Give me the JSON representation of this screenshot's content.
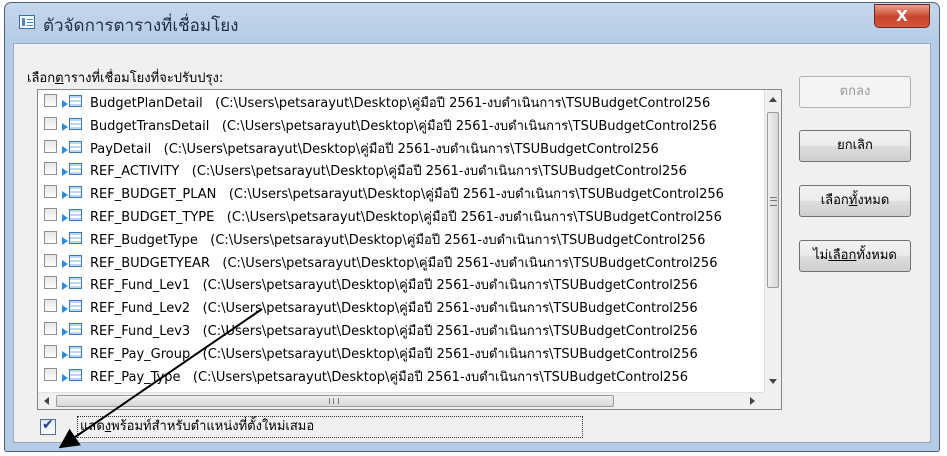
{
  "window": {
    "title": "ตัวจัดการตารางที่เชื่อมโยง",
    "close_glyph": "X"
  },
  "prompt": {
    "prefix": "เลือก",
    "accel": "ต",
    "rest": "ารางที่เชื่อมโยงที่จะปรับปรุง:"
  },
  "tables": [
    {
      "name": "BudgetPlanDetail",
      "path": "(C:\\Users\\petsarayut\\Desktop\\คู่มือปี  2561-งบดำเนินการ\\TSUBudgetControl256"
    },
    {
      "name": "BudgetTransDetail",
      "path": "(C:\\Users\\petsarayut\\Desktop\\คู่มือปี  2561-งบดำเนินการ\\TSUBudgetControl256"
    },
    {
      "name": "PayDetail",
      "path": "(C:\\Users\\petsarayut\\Desktop\\คู่มือปี  2561-งบดำเนินการ\\TSUBudgetControl256"
    },
    {
      "name": "REF_ACTIVITY",
      "path": "(C:\\Users\\petsarayut\\Desktop\\คู่มือปี  2561-งบดำเนินการ\\TSUBudgetControl256"
    },
    {
      "name": "REF_BUDGET_PLAN",
      "path": "(C:\\Users\\petsarayut\\Desktop\\คู่มือปี  2561-งบดำเนินการ\\TSUBudgetControl256"
    },
    {
      "name": "REF_BUDGET_TYPE",
      "path": "(C:\\Users\\petsarayut\\Desktop\\คู่มือปี  2561-งบดำเนินการ\\TSUBudgetControl256"
    },
    {
      "name": "REF_BudgetType",
      "path": "(C:\\Users\\petsarayut\\Desktop\\คู่มือปี  2561-งบดำเนินการ\\TSUBudgetControl256"
    },
    {
      "name": "REF_BUDGETYEAR",
      "path": "(C:\\Users\\petsarayut\\Desktop\\คู่มือปี  2561-งบดำเนินการ\\TSUBudgetControl256"
    },
    {
      "name": "REF_Fund_Lev1",
      "path": "(C:\\Users\\petsarayut\\Desktop\\คู่มือปี  2561-งบดำเนินการ\\TSUBudgetControl256"
    },
    {
      "name": "REF_Fund_Lev2",
      "path": "(C:\\Users\\petsarayut\\Desktop\\คู่มือปี  2561-งบดำเนินการ\\TSUBudgetControl256"
    },
    {
      "name": "REF_Fund_Lev3",
      "path": "(C:\\Users\\petsarayut\\Desktop\\คู่มือปี  2561-งบดำเนินการ\\TSUBudgetControl256"
    },
    {
      "name": "REF_Pay_Group",
      "path": "(C:\\Users\\petsarayut\\Desktop\\คู่มือปี  2561-งบดำเนินการ\\TSUBudgetControl256"
    },
    {
      "name": "REF_Pay_Type",
      "path": "(C:\\Users\\petsarayut\\Desktop\\คู่มือปี  2561-งบดำเนินการ\\TSUBudgetControl256"
    }
  ],
  "buttons": {
    "ok": "ตกลง",
    "cancel": "ยกเลิก",
    "select_all": {
      "prefix": "เลือก",
      "accel": "ทั้",
      "suffix": "งหมด"
    },
    "deselect_all": {
      "prefix": "ไม่",
      "accel": "เลือก",
      "suffix": "ทั้งหมด"
    }
  },
  "always_prompt": {
    "checked": true,
    "check_glyph": "✔",
    "prefix": "แสด",
    "accel": "ง",
    "rest": "พร้อมท์สำหรับตำแหน่งที่ตั้งใหม่เสมอ"
  },
  "colors": {
    "titlebar": "#b9cee8",
    "close_button": "#c8442c",
    "annotation_arrow": "#000000"
  }
}
